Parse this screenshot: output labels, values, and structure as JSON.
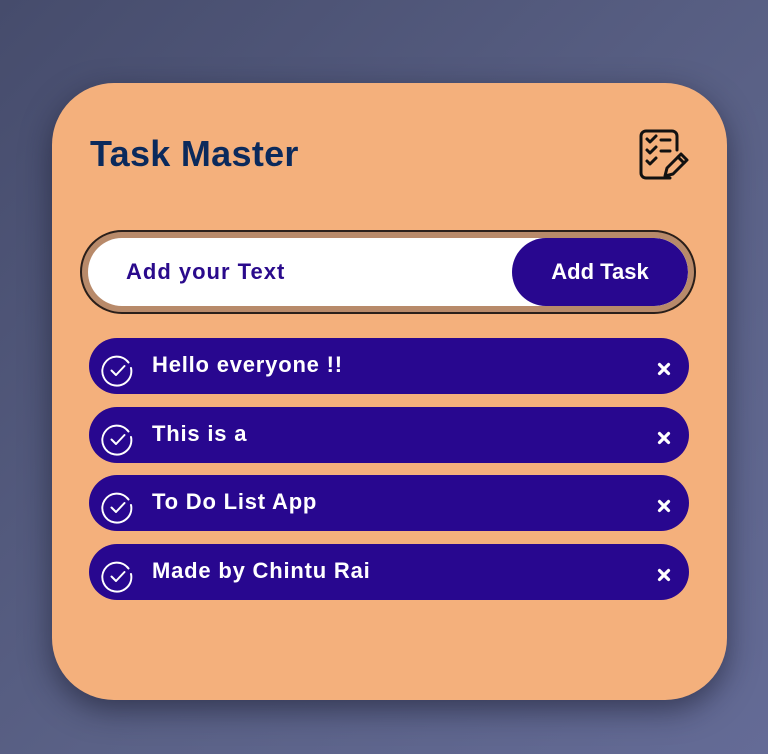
{
  "app": {
    "title": "Task Master",
    "icon": "checklist-edit-icon"
  },
  "input": {
    "placeholder": "Add your Text",
    "value": "",
    "button_label": "Add Task"
  },
  "tasks": [
    {
      "text": "Hello everyone !!",
      "completed": false
    },
    {
      "text": "This is a",
      "completed": false
    },
    {
      "text": "To Do List App",
      "completed": false
    },
    {
      "text": "Made by Chintu Rai",
      "completed": false
    }
  ],
  "icons": {
    "task_status": "check-circle-icon",
    "task_delete": "close-icon"
  },
  "colors": {
    "card_background": "#f4b07c",
    "accent": "#28078f",
    "title": "#0b2a5c",
    "page_background": "#5a6186"
  }
}
